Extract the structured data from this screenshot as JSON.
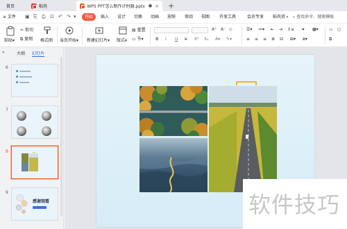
{
  "tabs": {
    "home": "首页",
    "wps": "稻壳",
    "doc_title": "WPS PPT怎么制作计时器.pptx",
    "doc_dot": "●"
  },
  "menu": {
    "file": "≡ 文件",
    "items": [
      "开始",
      "插入",
      "设计",
      "切换",
      "动画",
      "放映",
      "审阅",
      "视图",
      "开发工具",
      "会员专享",
      "稻壳资"
    ],
    "more": "»",
    "search": "查找命令、搜索模板"
  },
  "ribbon": {
    "paste": "粘贴",
    "cut": "剪切",
    "copy": "复制",
    "format_painter": "格式刷",
    "play_from_current": "当页开始",
    "new_slide": "新建幻灯片",
    "layout": "版式",
    "section": "节",
    "reset": "重置",
    "bold": "B",
    "italic": "I",
    "underline": "U",
    "strike": "S"
  },
  "leftpane": {
    "outline_tab": "大纲",
    "slides_tab": "幻灯片",
    "collapse": "«",
    "slides": [
      {
        "num": "6"
      },
      {
        "num": "7"
      },
      {
        "num": "8"
      },
      {
        "num": "9",
        "thanks_text": "感谢观看"
      }
    ]
  },
  "watermark": "软件技巧",
  "colors": {
    "accent": "#f5593d",
    "wps_red": "#e53935",
    "selection": "#f25a23",
    "bracket": "#f2b52c"
  }
}
